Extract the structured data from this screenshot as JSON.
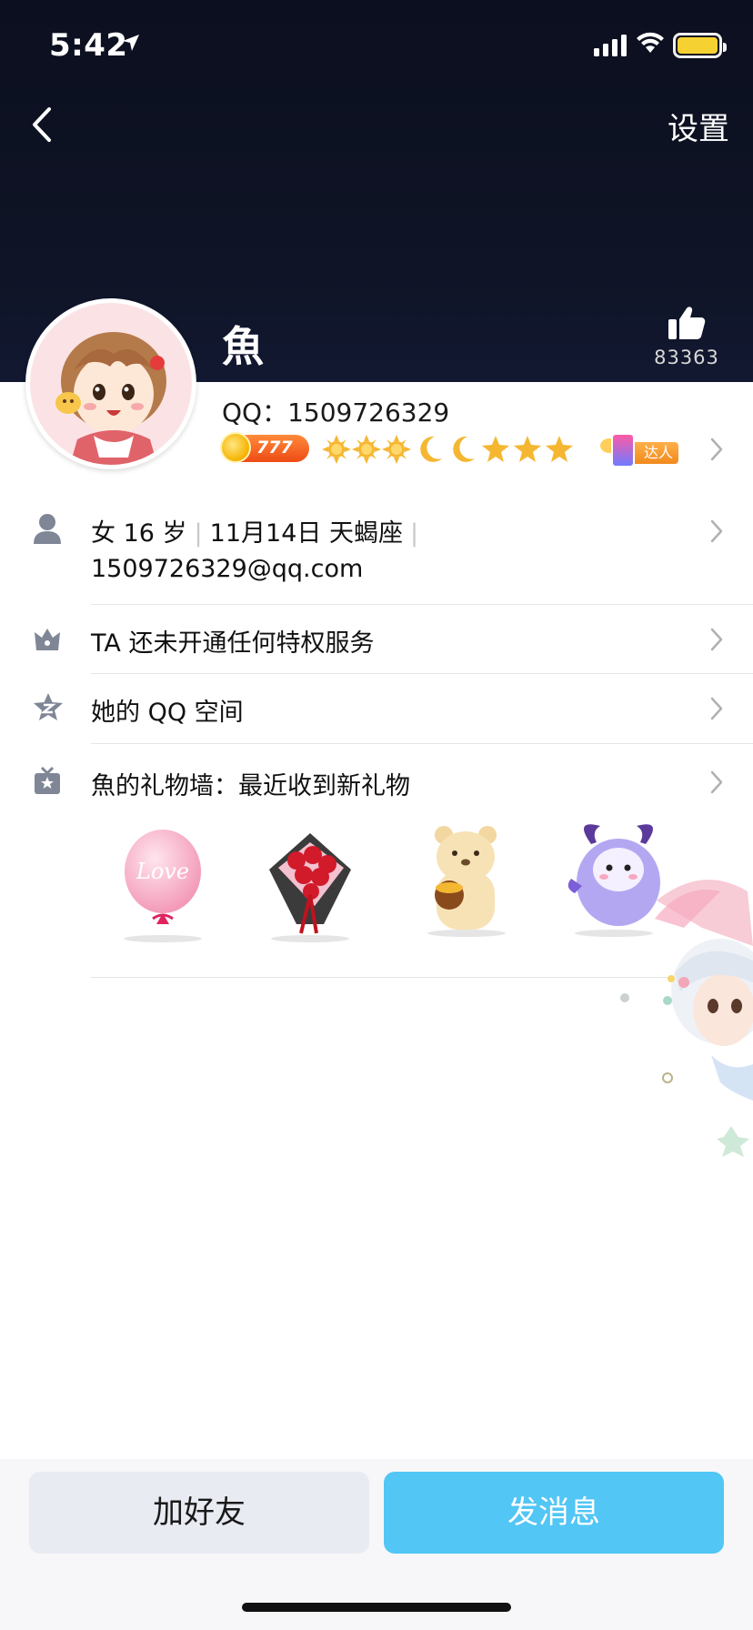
{
  "status_bar": {
    "time": "5:42"
  },
  "header": {
    "settings_label": "设置",
    "name": "魚",
    "like_count": "83363"
  },
  "profile": {
    "qq_label": "QQ：1509726329",
    "coin_value": "777",
    "level_icons": [
      "sun-icon",
      "sun-icon",
      "sun-icon",
      "moon-icon",
      "moon-icon",
      "star-icon",
      "star-icon",
      "star-icon"
    ],
    "badge_label": "达人"
  },
  "info_row": {
    "gender": "女",
    "age": "16 岁",
    "birthday": "11月14日",
    "zodiac": "天蝎座",
    "email": "1509726329@qq.com"
  },
  "rows": {
    "privilege": "TA 还未开通任何特权服务",
    "qzone": "她的 QQ 空间",
    "gift_wall": "魚的礼物墙：最近收到新礼物"
  },
  "gifts": [
    {
      "name": "love-balloon",
      "text": "Love"
    },
    {
      "name": "rose-bouquet"
    },
    {
      "name": "honey-bear"
    },
    {
      "name": "purple-monster"
    }
  ],
  "bottom": {
    "add_friend": "加好友",
    "send_message": "发消息"
  },
  "colors": {
    "header_bg": "#0f1426",
    "accent": "#52c6f5",
    "coin": "#ee4b16"
  }
}
